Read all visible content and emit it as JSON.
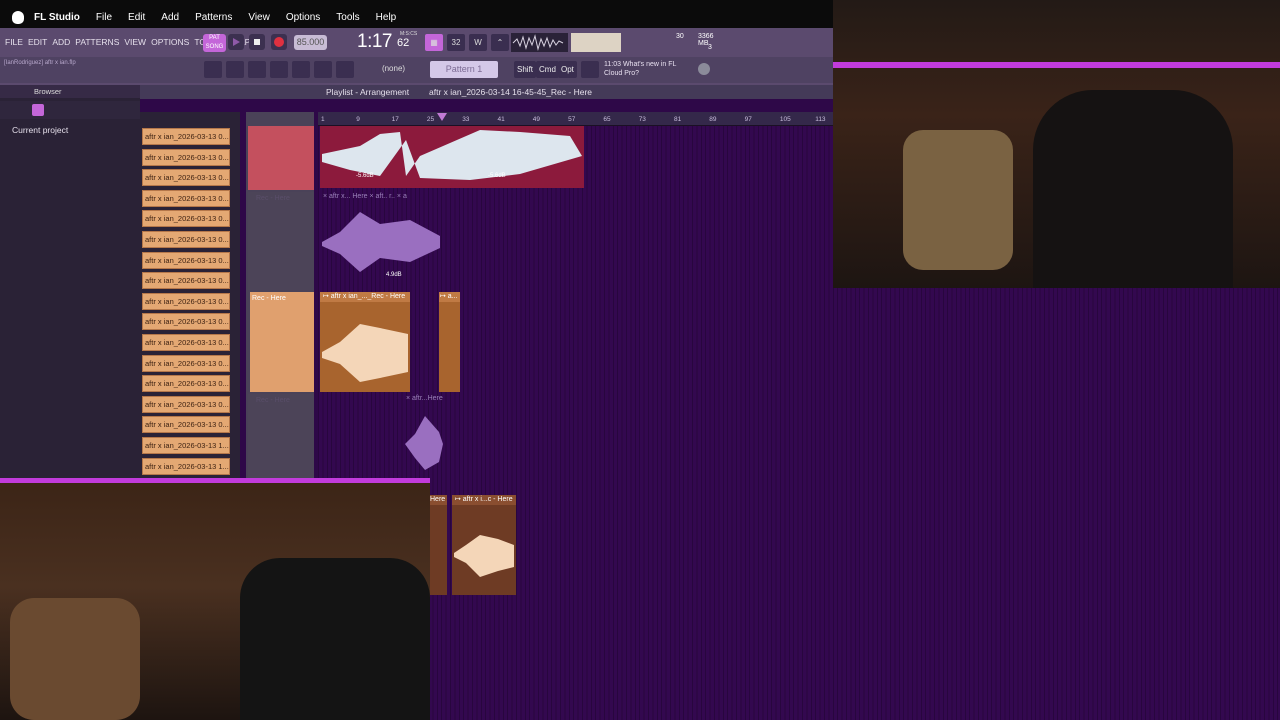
{
  "mac_menu": {
    "app": "FL Studio",
    "items": [
      "File",
      "Edit",
      "Add",
      "Patterns",
      "View",
      "Options",
      "Tools",
      "Help"
    ]
  },
  "fl_menu": [
    "FILE",
    "EDIT",
    "ADD",
    "PATTERNS",
    "VIEW",
    "OPTIONS",
    "TOOLS",
    "HELP"
  ],
  "transport": {
    "mode_top": "PAT",
    "mode_bottom": "SONG",
    "tempo": "85.000",
    "time": "1:17",
    "time_ms": "62",
    "time_unit": "M:S:CS"
  },
  "metrics": {
    "cpu_val": "30",
    "mem": "3366 MB",
    "poly": "3"
  },
  "toolbar2": {
    "user": "[IanRodriguez] aftr x ian.flp",
    "pattern_selector": "(none)",
    "pattern_name": "Pattern 1",
    "shift": "Shift",
    "cmd": "Cmd",
    "opt": "Opt",
    "news_time": "11:03",
    "news_text": "What's new in FL",
    "news_text2": "Cloud Pro?"
  },
  "browser": {
    "title": "Browser",
    "current_project": "Current project"
  },
  "playlist": {
    "title": "Playlist - Arrangement",
    "crumb": "aftr x ian_2026-03-14 16-45-45_Rec - Here"
  },
  "patterns": [
    "aftr x ian_2026-03-13 0...",
    "aftr x ian_2026-03-13 0...",
    "aftr x ian_2026-03-13 0...",
    "aftr x ian_2026-03-13 0...",
    "aftr x ian_2026-03-13 0...",
    "aftr x ian_2026-03-13 0...",
    "aftr x ian_2026-03-13 0...",
    "aftr x ian_2026-03-13 0...",
    "aftr x ian_2026-03-13 0...",
    "aftr x ian_2026-03-13 0...",
    "aftr x ian_2026-03-13 0...",
    "aftr x ian_2026-03-13 0...",
    "aftr x ian_2026-03-13 0...",
    "aftr x ian_2026-03-13 0...",
    "aftr x ian_2026-03-13 0...",
    "aftr x ian_2026-03-13 1...",
    "aftr x ian_2026-03-13 1..."
  ],
  "ruler": [
    "1",
    "9",
    "17",
    "25",
    "33",
    "41",
    "49",
    "57",
    "65",
    "73",
    "81",
    "89",
    "97",
    "105",
    "113"
  ],
  "tracks": {
    "t2": "Rec - Here",
    "t3": "Rec - Here",
    "t4": "Rec - Here"
  },
  "clips": {
    "c1_db": "-5.6dB",
    "c1_db2": "-5.6dB",
    "c2_title": "× aftr x... Here × aft.. r.. × a",
    "c2_db": "4.9dB",
    "c3_title": "↦ aftr x ian_..._Rec - Here",
    "c3b_title": "↦ a...",
    "c4_title": "× aftr...Here",
    "c5_title": "Here",
    "c6_title": "↦ aftr x i...c - Here"
  },
  "colors": {
    "accent": "#c466d9",
    "grid": "#33084f",
    "clip_red": "#8c1a3c",
    "clip_orange": "#a8642e"
  }
}
